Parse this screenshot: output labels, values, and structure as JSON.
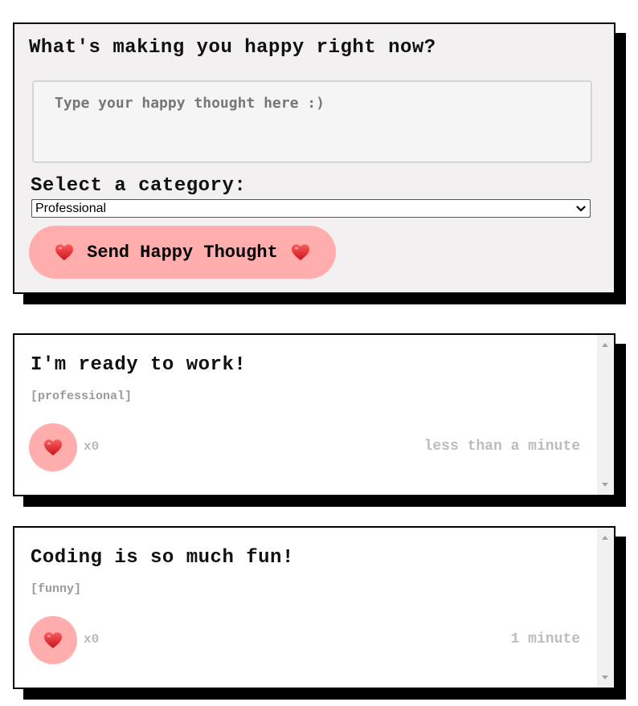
{
  "form": {
    "title": "What's making you happy right now?",
    "input_placeholder": "Type your happy thought here :)",
    "input_value": "",
    "category_label": "Select a category:",
    "category_selected": "Professional",
    "send_label": "Send Happy Thought",
    "icons": {
      "heart": "heart-icon",
      "dropdown": "chevron-down-icon"
    }
  },
  "thoughts": [
    {
      "message": "I'm ready to work!",
      "category": "[professional]",
      "likes": "x0",
      "time": "less than a minute"
    },
    {
      "message": "Coding is so much fun!",
      "category": "[funny]",
      "likes": "x0",
      "time": "1 minute"
    }
  ],
  "colors": {
    "accent_pink": "#ffadad",
    "heart_red": "#e8202c",
    "form_background": "#f2f0f0",
    "muted_text": "#bcbcbc"
  }
}
